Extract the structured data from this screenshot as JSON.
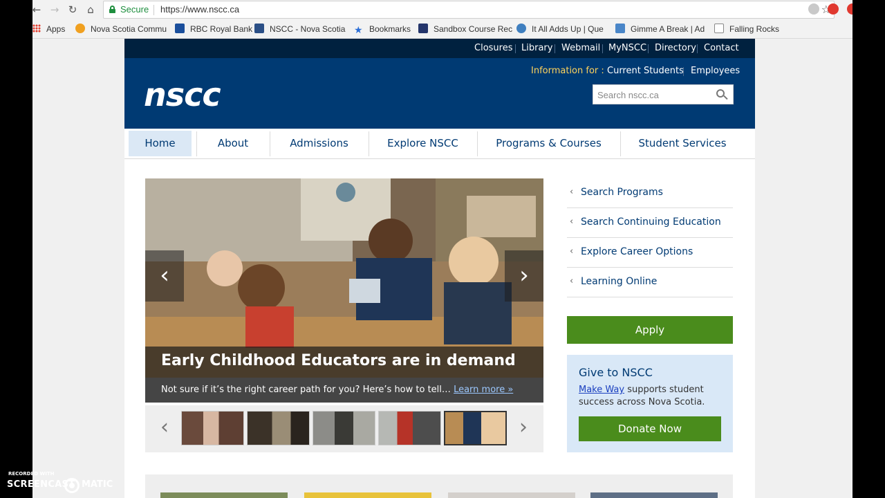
{
  "browser": {
    "secure_label": "Secure",
    "url": "https://www.nscc.ca",
    "bookmarks": [
      {
        "label": "Apps"
      },
      {
        "label": "Nova Scotia Commu"
      },
      {
        "label": "RBC Royal Bank"
      },
      {
        "label": "NSCC - Nova Scotia"
      },
      {
        "label": "Bookmarks"
      },
      {
        "label": "Sandbox Course Rec"
      },
      {
        "label": "It All Adds Up | Que"
      },
      {
        "label": "Gimme A Break | Ad"
      },
      {
        "label": "Falling Rocks"
      }
    ]
  },
  "utility_links": [
    "Closures",
    "Library",
    "Webmail",
    "MyNSCC",
    "Directory",
    "Contact"
  ],
  "header": {
    "logo": "nscc",
    "info_label": "Information for :",
    "info_links": [
      "Current Students",
      "Employees"
    ],
    "search_placeholder": "Search nscc.ca"
  },
  "main_nav": [
    "Home",
    "About",
    "Admissions",
    "Explore NSCC",
    "Programs & Courses",
    "Student Services"
  ],
  "carousel": {
    "title": "Early Childhood Educators are in demand",
    "subtitle": "Not sure if it’s the right career path for you? Here’s how to tell…",
    "link": "Learn more »",
    "prev_icon": "‹",
    "next_icon": "›"
  },
  "quick_links": [
    "Search Programs",
    "Search Continuing Education",
    "Explore Career Options",
    "Learning Online"
  ],
  "apply_label": "Apply",
  "give": {
    "title": "Give to NSCC",
    "link": "Make Way",
    "text": " supports student success across Nova Scotia.",
    "donate_label": "Donate Now"
  },
  "watermark": {
    "recorded_with": "RECORDED WITH",
    "brand_left": "SCREENCAST",
    "brand_right": "MATIC"
  },
  "colors": {
    "navy": "#003a73",
    "dark_navy": "#00213f",
    "apply_green": "#4a8c1c",
    "give_blue": "#d9e8f7"
  }
}
